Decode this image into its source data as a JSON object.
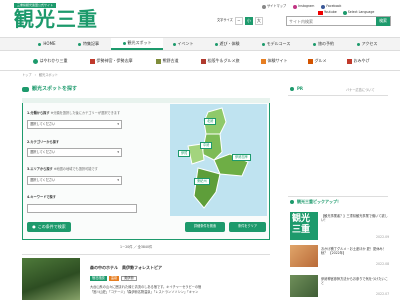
{
  "header": {
    "tagline": "三重県観光連盟公式サイト",
    "logo_text": "観光三重",
    "font_size_label": "文字サイズ",
    "font_sizes": [
      "−",
      "小",
      "大"
    ],
    "search_placeholder": "サイト内検索",
    "search_button": "検索",
    "sitemap": "サイトマップ",
    "instagram": "Instagram",
    "facebook": "Facebook",
    "youtube": "Youtube",
    "language": "Select Language",
    "brand_color": "#1d9a6c"
  },
  "nav": {
    "main": [
      "HOME",
      "特集記事",
      "観光スポット",
      "イベント",
      "遊び・体験",
      "モデルコース",
      "旅の予約",
      "アクセス"
    ],
    "active": "観光スポット",
    "sub": [
      "はやわかり三重",
      "伊勢神宮・伊勢志摩",
      "熊野古道",
      "松阪牛＆グルメ旅",
      "体験サイト",
      "グルメ",
      "おみやげ"
    ]
  },
  "breadcrumb": [
    "トップ",
    "観光スポット"
  ],
  "search": {
    "title": "観光スポットを探す",
    "q1_label": "1.分類から探す",
    "q1_hint": "※分類を選択した後にカテゴリーが選択できます",
    "q1_select": "選択してください",
    "q2_label": "2.カテゴリーから探す",
    "q2_select": "選択してください",
    "q3_label": "3.エリアから探す",
    "q3_hint": "※地図の地域でも選択可能です",
    "q3_select": "選択してください",
    "q4_label": "4.キーワードで探す",
    "search_btn": "この条件で検索",
    "detail_btn": "詳細条件を検索",
    "clear_btn": "条件をクリア"
  },
  "map": {
    "regions": [
      "北勢",
      "中勢",
      "伊賀",
      "伊勢志摩",
      "東紀州"
    ]
  },
  "results": {
    "count": "1－20件 ／ 全3840件"
  },
  "spot": {
    "title": "森の中のホテル　奥伊勢フォレストピア",
    "tags": [
      "宿泊施設",
      "温泉",
      "奥伊勢"
    ],
    "desc1": "大台山系の山々に囲まれた緑と清流のしある宿です。キイチャーセラピーの宿",
    "desc2": "「宮川山荘」「コテージ」「森伊勢名物温泉」「レストランソソシン」「キャン"
  },
  "sidebar": {
    "pr": "PR",
    "pr_note": "バナー広告について",
    "pickup_title": "観光三重ピックアップ！",
    "ribbon_text": "観光三重",
    "pickups": [
      {
        "text": "【観光事業者？】三重県観光事業で働いて欲しい！",
        "date": "2022.09"
      },
      {
        "text": "おかげ横丁グルメ・お土産ほか 夏！夏休み！秋？ 【2022年】",
        "date": "2022.08"
      },
      {
        "text": "伊勢神宮参拝方法からお参りで気をつけたいこと",
        "date": "2022.07"
      }
    ]
  }
}
